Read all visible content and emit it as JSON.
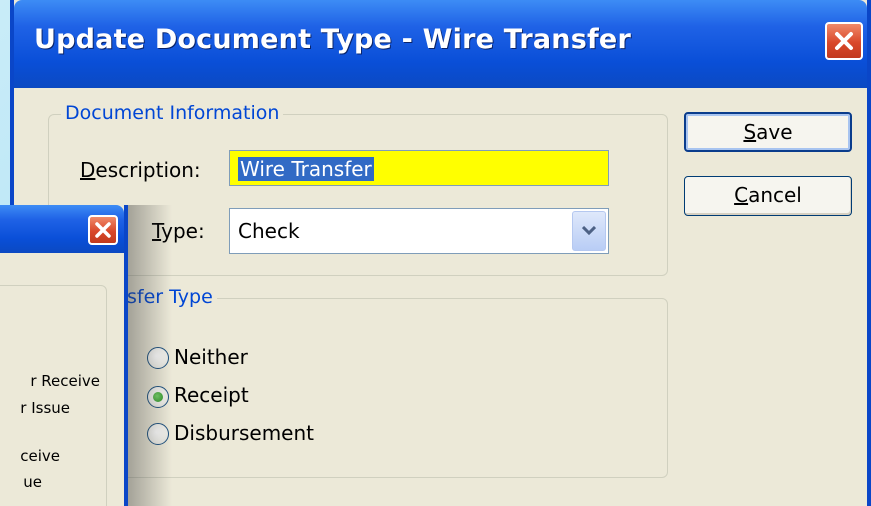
{
  "main_dialog": {
    "title": "Update Document Type - Wire Transfer",
    "doc_info": {
      "group_title": "Document Information",
      "description_label_accel": "D",
      "description_label_rest": "escription:",
      "description_value": "Wire Transfer",
      "type_label_accel": "T",
      "type_label_rest": "ype:",
      "type_value": "Check"
    },
    "transfer_type": {
      "group_title_visible": "sfer Type",
      "options": [
        "Neither",
        "Receipt",
        "Disbursement"
      ],
      "selected": "Receipt"
    },
    "buttons": {
      "save_accel": "S",
      "save_rest": "ave",
      "cancel_accel": "C",
      "cancel_rest": "ancel"
    }
  },
  "back_dialog": {
    "visible_text": [
      "r Receive",
      "r Issue",
      "ceive",
      "ue"
    ]
  },
  "colors": {
    "titlebar_blue": "#0a4fd8",
    "dialog_face": "#ece9d8",
    "groupbox_title": "#0046d5",
    "highlight_field": "#ffff00",
    "selection": "#316ac5",
    "close_red": "#d9482a"
  }
}
